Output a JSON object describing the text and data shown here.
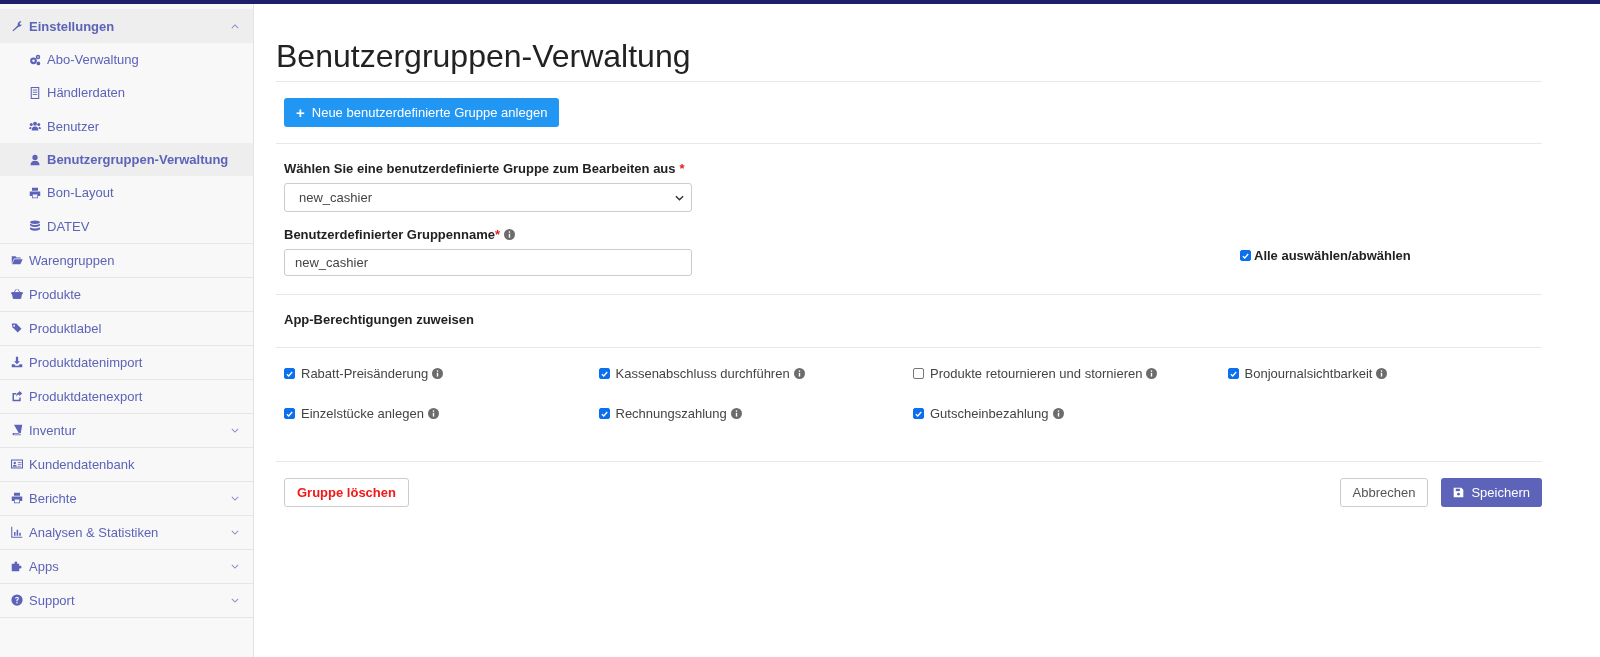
{
  "sidebar": {
    "items": [
      {
        "label": "Einstellungen",
        "expandable": true,
        "expanded": true,
        "children": [
          {
            "label": "Abo-Verwaltung",
            "selected": false
          },
          {
            "label": "Händlerdaten",
            "selected": false
          },
          {
            "label": "Benutzer",
            "selected": false
          },
          {
            "label": "Benutzergruppen-Verwaltung",
            "selected": true
          },
          {
            "label": "Bon-Layout",
            "selected": false
          },
          {
            "label": "DATEV",
            "selected": false
          }
        ]
      },
      {
        "label": "Warengruppen",
        "expandable": false,
        "expanded": false
      },
      {
        "label": "Produkte",
        "expandable": false,
        "expanded": false
      },
      {
        "label": "Produktlabel",
        "expandable": false,
        "expanded": false
      },
      {
        "label": "Produktdatenimport",
        "expandable": false,
        "expanded": false
      },
      {
        "label": "Produktdatenexport",
        "expandable": false,
        "expanded": false
      },
      {
        "label": "Inventur",
        "expandable": true,
        "expanded": false
      },
      {
        "label": "Kundendatenbank",
        "expandable": false,
        "expanded": false
      },
      {
        "label": "Berichte",
        "expandable": true,
        "expanded": false
      },
      {
        "label": "Analysen & Statistiken",
        "expandable": true,
        "expanded": false
      },
      {
        "label": "Apps",
        "expandable": true,
        "expanded": false
      },
      {
        "label": "Support",
        "expandable": true,
        "expanded": false
      }
    ]
  },
  "page": {
    "title": "Benutzergruppen-Verwaltung",
    "new_group_button": {
      "icon": "+",
      "label": "Neue benutzerdefinierte Gruppe anlegen"
    },
    "group_select": {
      "label": "Wählen Sie eine benutzerdefinierte Gruppe zum Bearbeiten aus",
      "required_mark": "*",
      "value": "new_cashier"
    },
    "group_name": {
      "label": "Benutzerdefinierter Gruppenname",
      "required_mark": "*",
      "value": "new_cashier"
    },
    "select_all": {
      "label": "Alle auswählen/abwählen",
      "checked": true
    },
    "permissions_heading": "App-Berechtigungen zuweisen",
    "permissions": [
      {
        "label": "Rabatt-Preisänderung",
        "checked": true
      },
      {
        "label": "Kassenabschluss durchführen",
        "checked": true
      },
      {
        "label": "Produkte retournieren und stornieren",
        "checked": false
      },
      {
        "label": "Bonjournalsichtbarkeit",
        "checked": true
      },
      {
        "label": "Einzelstücke anlegen",
        "checked": true
      },
      {
        "label": "Rechnungszahlung",
        "checked": true
      },
      {
        "label": "Gutscheinbezahlung",
        "checked": true
      }
    ],
    "delete_button": "Gruppe löschen",
    "cancel_button": "Abbrechen",
    "save_button": "Speichern"
  }
}
